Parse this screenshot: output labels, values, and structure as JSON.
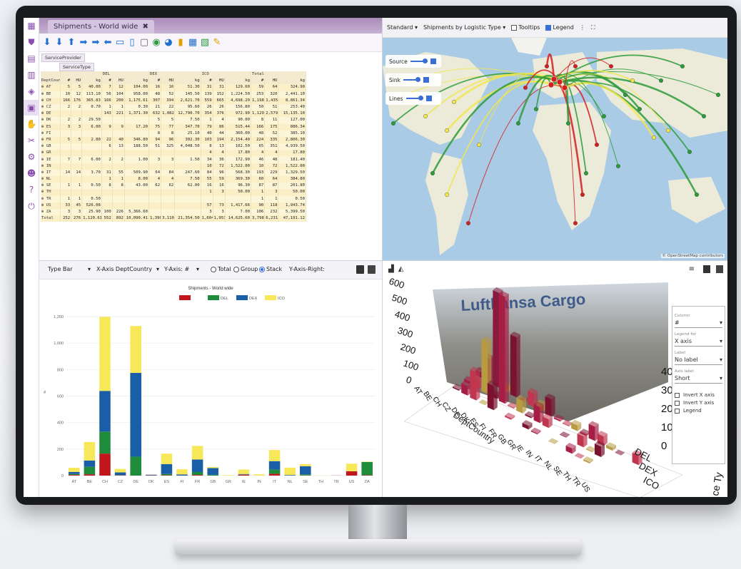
{
  "app": {
    "tab_title": "Shipments - World wide",
    "tab_close": "✖"
  },
  "icons": [
    "apps-grid-icon",
    "shield-icon",
    "report-icon",
    "document-icon",
    "layers-icon",
    "truck-icon",
    "hand-icon",
    "tools-icon",
    "settings-icon",
    "user-icon",
    "help-icon",
    "power-icon"
  ],
  "pivot": {
    "header_row_1": "ServiceProvider",
    "header_row_2": "ServiceType",
    "groups": [
      "DEL",
      "DEX",
      "ICO",
      "Total"
    ],
    "col_headers": [
      "DeptCountry",
      "#",
      "HU",
      "kg",
      "#",
      "HU",
      "kg",
      "#",
      "HU",
      "kg",
      "#",
      "HU",
      "kg",
      "#",
      "HU",
      "kg"
    ],
    "rows": [
      [
        "⊕ AT",
        "5",
        "5",
        "40.00",
        "7",
        "12",
        "104.00",
        "16",
        "16",
        "51.30",
        "31",
        "31",
        "129.60",
        "59",
        "64",
        "324.90"
      ],
      [
        "⊕ BE",
        "10",
        "12",
        "113.10",
        "56",
        "104",
        "958.00",
        "48",
        "52",
        "145.50",
        "139",
        "152",
        "1,224.50",
        "253",
        "320",
        "2,441.10"
      ],
      [
        "⊕ CH",
        "166",
        "176",
        "365.83",
        "166",
        "200",
        "1,175.61",
        "307",
        "394",
        "2,621.70",
        "559",
        "665",
        "4,698.20",
        "1,198",
        "1,435",
        "8,861.34"
      ],
      [
        "⊕ CZ",
        "2",
        "2",
        "0.70",
        "1",
        "1",
        "0.30",
        "21",
        "22",
        "95.60",
        "26",
        "26",
        "156.80",
        "50",
        "51",
        "253.40"
      ],
      [
        "⊕ DE",
        "",
        "",
        "",
        "143",
        "221",
        "1,371.30",
        "632",
        "1,082",
        "12,790.70",
        "354",
        "376",
        "972.90",
        "1,129",
        "2,579",
        "15,135.10"
      ],
      [
        "⊕ DK",
        "2",
        "2",
        "29.50",
        "",
        "",
        "",
        "5",
        "5",
        "7.50",
        "1",
        "4",
        "90.00",
        "8",
        "11",
        "127.00"
      ],
      [
        "⊕ ES",
        "3",
        "3",
        "6.00",
        "9",
        "9",
        "17.20",
        "75",
        "77",
        "347.70",
        "79",
        "86",
        "515.44",
        "166",
        "175",
        "886.34"
      ],
      [
        "⊕ FI",
        "",
        "",
        "",
        "",
        "",
        "",
        "8",
        "8",
        "25.10",
        "40",
        "44",
        "360.00",
        "48",
        "52",
        "385.10"
      ],
      [
        "⊕ FR",
        "5",
        "5",
        "2.80",
        "22",
        "40",
        "346.80",
        "94",
        "96",
        "302.30",
        "103",
        "194",
        "2,154.40",
        "224",
        "335",
        "2,806.30"
      ],
      [
        "⊕ GB",
        "",
        "",
        "",
        "6",
        "13",
        "188.50",
        "51",
        "325",
        "4,048.50",
        "8",
        "13",
        "102.50",
        "65",
        "351",
        "4,939.50"
      ],
      [
        "⊕ GR",
        "",
        "",
        "",
        "",
        "",
        "",
        "",
        "",
        "",
        "4",
        "4",
        "17.80",
        "4",
        "4",
        "17.80"
      ],
      [
        "⊕ IE",
        "7",
        "7",
        "6.00",
        "2",
        "2",
        "1.00",
        "3",
        "3",
        "1.50",
        "34",
        "36",
        "172.90",
        "46",
        "48",
        "181.40"
      ],
      [
        "⊕ IN",
        "",
        "",
        "",
        "",
        "",
        "",
        "",
        "",
        "",
        "10",
        "72",
        "1,522.00",
        "10",
        "72",
        "1,522.00"
      ],
      [
        "⊕ IT",
        "14",
        "14",
        "3.70",
        "31",
        "55",
        "509.90",
        "64",
        "84",
        "247.60",
        "84",
        "96",
        "568.30",
        "193",
        "229",
        "1,329.50"
      ],
      [
        "⊕ NL",
        "",
        "",
        "",
        "1",
        "1",
        "8.00",
        "4",
        "4",
        "7.50",
        "55",
        "59",
        "369.30",
        "60",
        "64",
        "384.80"
      ],
      [
        "⊕ SE",
        "1",
        "1",
        "0.50",
        "8",
        "8",
        "43.00",
        "62",
        "62",
        "62.00",
        "16",
        "16",
        "96.30",
        "87",
        "87",
        "201.80"
      ],
      [
        "⊕ TH",
        "",
        "",
        "",
        "",
        "",
        "",
        "",
        "",
        "",
        "1",
        "3",
        "50.00",
        "1",
        "3",
        "50.00"
      ],
      [
        "⊕ TR",
        "1",
        "1",
        "0.50",
        "",
        "",
        "",
        "",
        "",
        "",
        "",
        "",
        "",
        "1",
        "1",
        "0.50"
      ],
      [
        "⊕ US",
        "33",
        "45",
        "526.08",
        "",
        "",
        "",
        "",
        "",
        "",
        "57",
        "73",
        "1,417.66",
        "90",
        "118",
        "1,943.74"
      ],
      [
        "⊕ ZA",
        "3",
        "3",
        "25.90",
        "100",
        "226",
        "5,366.60",
        "",
        "",
        "",
        "3",
        "3",
        "7.00",
        "106",
        "232",
        "5,399.50"
      ],
      [
        "Total",
        "252",
        "276",
        "1,120.61",
        "552",
        "892",
        "10,090.41",
        "1,390",
        "3,110",
        "21,354.50",
        "1,604",
        "1,953",
        "14,625.60",
        "3,798",
        "6,231",
        "47,191.12"
      ]
    ]
  },
  "map": {
    "view": "Standard",
    "layer": "Shipments by Logistic Type",
    "tooltips_label": "Tooltips",
    "legend_label": "Legend",
    "controls": [
      "Source",
      "Sink",
      "Lines"
    ],
    "attribution": "© OpenStreetMap contributors",
    "colors": {
      "del": "#2e9b3a",
      "dex": "#1f5fb0",
      "ico": "#f2e64a",
      "red": "#d41f1f"
    }
  },
  "barpanel": {
    "type_label": "Type Bar",
    "xaxis_label": "X-Axis DeptCountry",
    "yaxis_label": "Y-Axis: #",
    "total_label": "Total",
    "group_label": "Group",
    "stack_label": "Stack",
    "yaxis_right_label": "Y-Axis-Right:"
  },
  "chart_data": {
    "type": "bar",
    "title": "Shipments - World wide",
    "ylabel": "#",
    "ylim": [
      0,
      1200
    ],
    "yticks": [
      0,
      200,
      400,
      600,
      800,
      1000,
      1200
    ],
    "ytick_labels": [
      "0",
      "200",
      "400",
      "600",
      "800",
      "1,000",
      "1,200"
    ],
    "categories": [
      "AT",
      "BE",
      "CH",
      "CZ",
      "DE",
      "DK",
      "ES",
      "FI",
      "FR",
      "GB",
      "GR",
      "IE",
      "IN",
      "IT",
      "NL",
      "SE",
      "TH",
      "TR",
      "US",
      "ZA"
    ],
    "series": [
      {
        "name": "",
        "color": "#c0161c",
        "values": [
          5,
          10,
          166,
          2,
          0,
          2,
          3,
          0,
          5,
          0,
          0,
          7,
          0,
          14,
          0,
          1,
          0,
          1,
          33,
          3
        ]
      },
      {
        "name": "DEL",
        "color": "#1e8c3a",
        "values": [
          7,
          56,
          166,
          1,
          143,
          0,
          9,
          0,
          22,
          6,
          0,
          2,
          0,
          31,
          1,
          8,
          0,
          0,
          0,
          100
        ]
      },
      {
        "name": "DEX",
        "color": "#1a5ea8",
        "values": [
          16,
          48,
          307,
          21,
          632,
          5,
          75,
          8,
          94,
          51,
          0,
          3,
          0,
          64,
          4,
          62,
          0,
          0,
          0,
          0
        ]
      },
      {
        "name": "ICO",
        "color": "#f7e85a",
        "values": [
          31,
          139,
          559,
          26,
          354,
          1,
          79,
          40,
          103,
          8,
          4,
          34,
          10,
          84,
          55,
          16,
          1,
          0,
          57,
          3
        ]
      }
    ]
  },
  "threed": {
    "axis_title": "DeptCountry",
    "zticks": [
      "600",
      "500",
      "400",
      "300",
      "200",
      "100",
      "0"
    ],
    "xcats": [
      "AT",
      "BE",
      "CH",
      "CZ",
      "DE",
      "DK",
      "ES",
      "FI",
      "FR",
      "GB",
      "GR",
      "IE",
      "IN",
      "IT",
      "NL",
      "SE",
      "TH",
      "TR",
      "US"
    ],
    "ycats": [
      "DEL",
      "DEX",
      "ICO"
    ],
    "banner_text": "Lufthansa Cargo",
    "ghost_ticks": [
      "400",
      "300",
      "200",
      "100",
      "0"
    ],
    "side_axis_fragment": "ce Ty",
    "side": {
      "column_label": "Column",
      "column_value": "#",
      "legend_label": "Legend for",
      "legend_value": "X axis",
      "label_label": "Label",
      "label_value": "No label",
      "axislabel_label": "Axis label",
      "axislabel_value": "Short",
      "invert_x": "Invert X axis",
      "invert_y": "Invert Y axis",
      "legend_cb": "Legend"
    }
  }
}
